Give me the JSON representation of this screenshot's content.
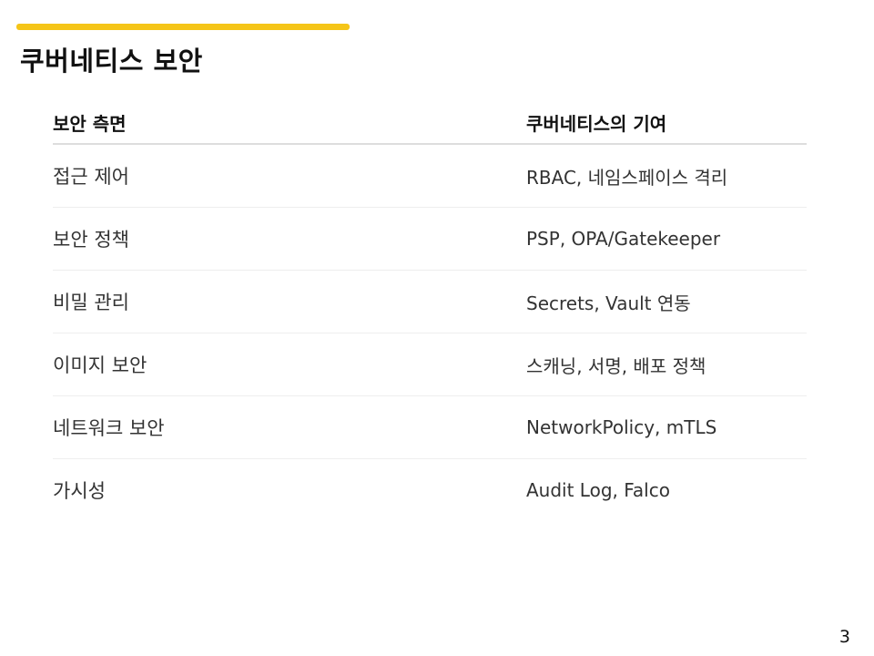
{
  "slide": {
    "title": "쿠버네티스 보안",
    "page_number": "3",
    "accent_color": "#f5c518"
  },
  "table": {
    "headers": {
      "aspect": "보안 측면",
      "contribution": "쿠버네티스의 기여"
    },
    "rows": [
      {
        "aspect": "접근 제어",
        "contribution": "RBAC, 네임스페이스 격리"
      },
      {
        "aspect": "보안 정책",
        "contribution": "PSP, OPA/Gatekeeper"
      },
      {
        "aspect": "비밀 관리",
        "contribution": "Secrets, Vault 연동"
      },
      {
        "aspect": "이미지 보안",
        "contribution": "스캐닝, 서명, 배포 정책"
      },
      {
        "aspect": "네트워크 보안",
        "contribution": "NetworkPolicy, mTLS"
      },
      {
        "aspect": "가시성",
        "contribution": "Audit Log, Falco"
      }
    ]
  }
}
